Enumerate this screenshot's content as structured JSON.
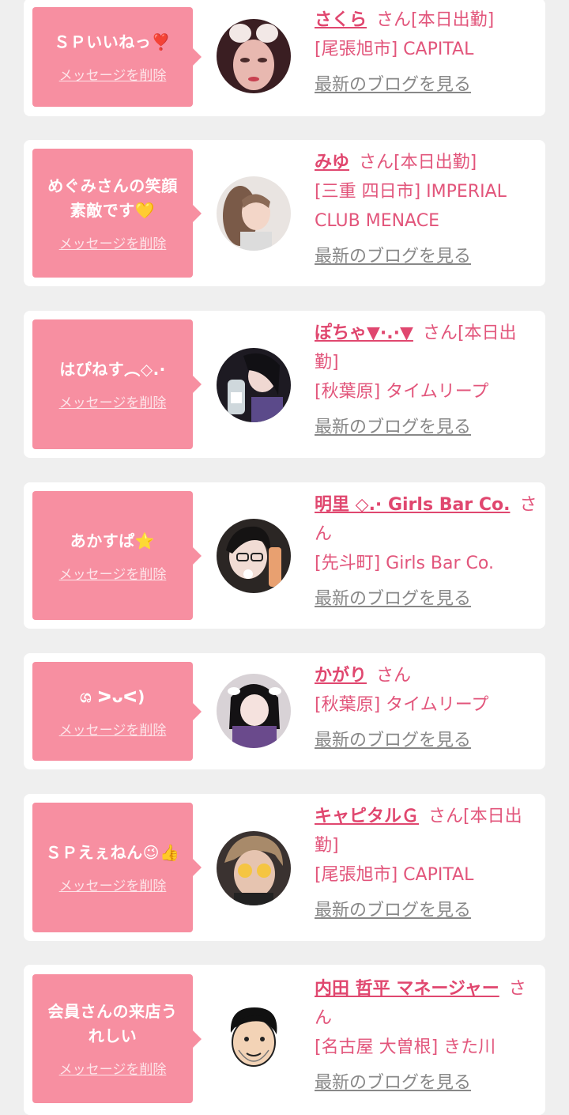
{
  "suffix": "さん",
  "delete_label": "メッセージを削除",
  "blog_label": "最新のブログを見る",
  "messages": [
    {
      "text": "ＳＰいいねっ❣️",
      "cast_name": "さくら",
      "status": "[本日出勤]",
      "shop": "[尾張旭市] CAPITAL"
    },
    {
      "text": "めぐみさんの笑顔素敵です💛",
      "cast_name": "みゆ",
      "status": "[本日出勤]",
      "shop": "[三重 四日市] IMPERIAL CLUB MENACE"
    },
    {
      "text": "はぴねす︵◇.·",
      "cast_name": "ぽちゃ▼·.·▼",
      "status": "[本日出勤]",
      "shop": "[秋葉原] タイムリープ"
    },
    {
      "text": "あかすぱ⭐",
      "cast_name": "明里 ◇.· Girls Bar Co.",
      "status": "",
      "shop": "[先斗町] Girls Bar Co."
    },
    {
      "text": "ශ ᐳᴗᐸ)",
      "cast_name": "かがり",
      "status": "",
      "shop": "[秋葉原] タイムリープ"
    },
    {
      "text": "ＳＰえぇねん😉👍",
      "cast_name": "キャピタルＧ",
      "status": "[本日出勤]",
      "shop": "[尾張旭市] CAPITAL"
    },
    {
      "text": "会員さんの来店うれしい",
      "cast_name": "内田 哲平 マネージャー",
      "status": "",
      "shop": "[名古屋 大曽根] きた川"
    }
  ]
}
